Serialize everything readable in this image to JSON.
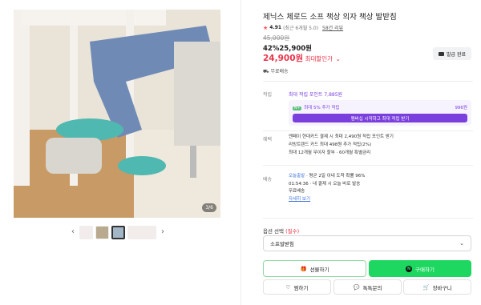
{
  "gallery": {
    "counter": "3/6",
    "prev_arrow": "‹",
    "next_arrow": "›"
  },
  "product": {
    "title": "제닉스 체로드 소프 책상 의자 책상 발받침",
    "rating": "4.91",
    "rating_note": "(최근 6개월 5.0)",
    "review_count": "58건 리뷰",
    "original_price": "45,000원",
    "discount_price": "42%25,900원",
    "max_price": "24,900원",
    "max_label": " 최대할인가",
    "coupon_label": "발급 완료",
    "shipping_short": "무료배송"
  },
  "points": {
    "label": "적립",
    "title": "최대 적립 포인트 7,885원",
    "line_badge": "N+",
    "line_text": "최대 5% 추가 적립",
    "line_value": "996원",
    "cta": "멤버십 시작하고 최대 적립 받기"
  },
  "benefits": {
    "label": "혜택",
    "lines": [
      "엔페이 현대카드 결제 시 최대 2,490원 적립 포인트 받기",
      "리빙트렌드 카드 최대 498원 추가 적립(2%)",
      "최대 12개월 무이자 할부 · 60개월 특별금리"
    ]
  },
  "delivery": {
    "label": "배송",
    "line1_blue": "오늘출발",
    "line1_rest": " · 평균 2일 이내 도착 확률 96%",
    "line2": "01:54:36 · 내 결제 시 오늘 바로 발송",
    "line3": "무료배송",
    "more": "자세히 보기"
  },
  "options": {
    "label": "옵션 선택",
    "required": "(필수)",
    "selected": "소프발받침"
  },
  "actions": {
    "gift": "선물하기",
    "buy": "구매하기",
    "wish": "찜하기",
    "talk": "톡톡문의",
    "cart": "장바구니"
  },
  "colors": {
    "price_red": "#e8364b",
    "buy_green": "#1ed760",
    "point_purple": "#7a3fdc"
  }
}
